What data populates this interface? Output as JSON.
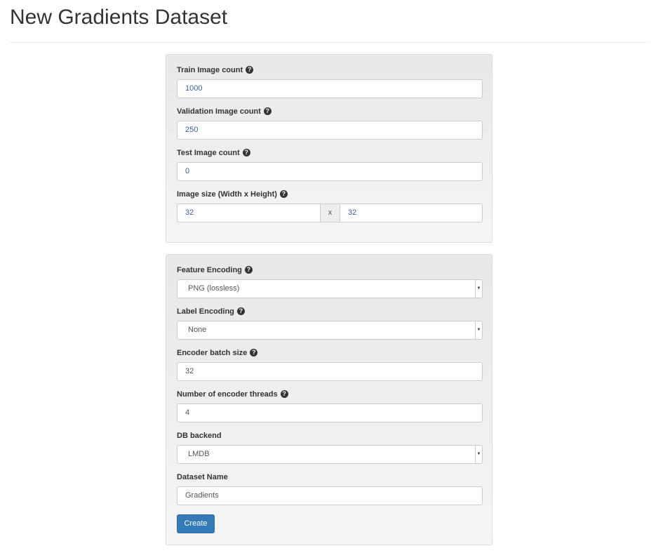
{
  "title": "New Gradients Dataset",
  "panel1": {
    "train": {
      "label": "Train Image count",
      "value": "1000"
    },
    "val": {
      "label": "Validation Image count",
      "value": "250"
    },
    "test": {
      "label": "Test Image count",
      "value": "0"
    },
    "size": {
      "label": "Image size (Width x Height)",
      "width": "32",
      "sep": "x",
      "height": "32"
    }
  },
  "panel2": {
    "feature": {
      "label": "Feature Encoding",
      "value": "PNG (lossless)"
    },
    "labelenc": {
      "label": "Label Encoding",
      "value": "None"
    },
    "batch": {
      "label": "Encoder batch size",
      "value": "32"
    },
    "threads": {
      "label": "Number of encoder threads",
      "value": "4"
    },
    "backend": {
      "label": "DB backend",
      "value": "LMDB"
    },
    "name": {
      "label": "Dataset Name",
      "value": "Gradients"
    },
    "create": "Create"
  },
  "help_icon": "?",
  "caret_icon": "▼"
}
